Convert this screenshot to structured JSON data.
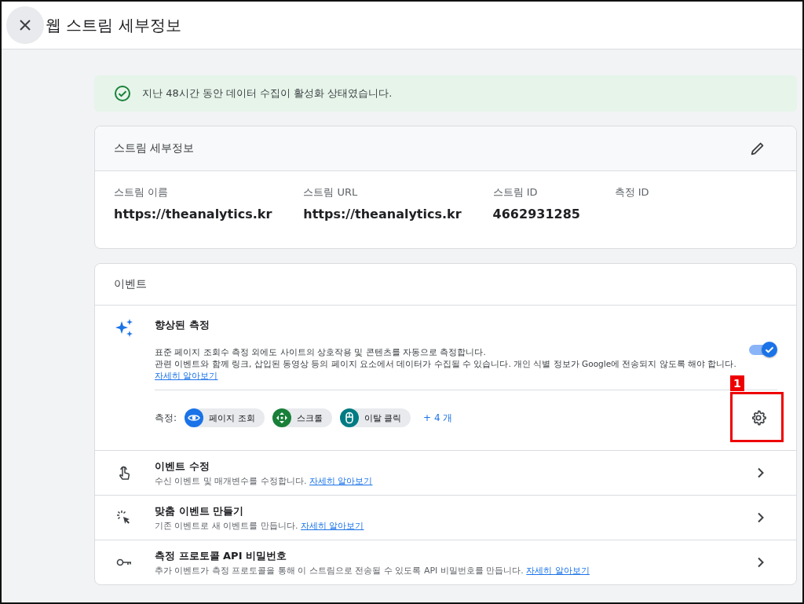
{
  "header": {
    "title": "웹 스트림 세부정보"
  },
  "banner": {
    "text": "지난 48시간 동안 데이터 수집이 활성화 상태였습니다."
  },
  "stream_details": {
    "title": "스트림 세부정보",
    "fields": [
      {
        "label": "스트림 이름",
        "value": "https://theanalytics.kr"
      },
      {
        "label": "스트림 URL",
        "value": "https://theanalytics.kr"
      },
      {
        "label": "스트림 ID",
        "value": "4662931285"
      },
      {
        "label": "측정 ID"
      }
    ]
  },
  "events": {
    "title": "이벤트",
    "enhanced": {
      "title": "향상된 측정",
      "description": "표준 페이지 조회수 측정 외에도 사이트의 상호작용 및 콘텐츠를 자동으로 측정합니다.",
      "description_2": "관련 이벤트와 함께 링크, 삽입된 동영상 등의 페이지 요소에서 데이터가 수집될 수 있습니다. 개인 식별 정보가 Google에 전송되지 않도록 해야 합니다.",
      "link": "자세히 알아보기",
      "on": true,
      "measure_label": "측정:",
      "chips": [
        {
          "kind": "eye",
          "label": "페이지 조회",
          "color": "#1a73e8"
        },
        {
          "kind": "scroll",
          "label": "스크롤",
          "color": "#188038"
        },
        {
          "kind": "mouse",
          "label": "이탈 클릭",
          "color": "#007b83"
        }
      ],
      "more": "+ 4 개",
      "annotation": "1"
    },
    "rows": [
      {
        "kind": "touch",
        "title": "이벤트 수정",
        "description": "수신 이벤트 및 매개변수를 수정합니다.",
        "link": "자세히 알아보기"
      },
      {
        "kind": "sparkle",
        "title": "맞춤 이벤트 만들기",
        "description": "기존 이벤트로 새 이벤트를 만듭니다.",
        "link": "자세히 알아보기"
      },
      {
        "kind": "key",
        "title": "측정 프로토콜 API 비밀번호",
        "description": "추가 이벤트가 측정 프로토콜을 통해 이 스트림으로 전송될 수 있도록 API 비밀번호를 만듭니다.",
        "link": "자세히 알아보기"
      }
    ]
  }
}
